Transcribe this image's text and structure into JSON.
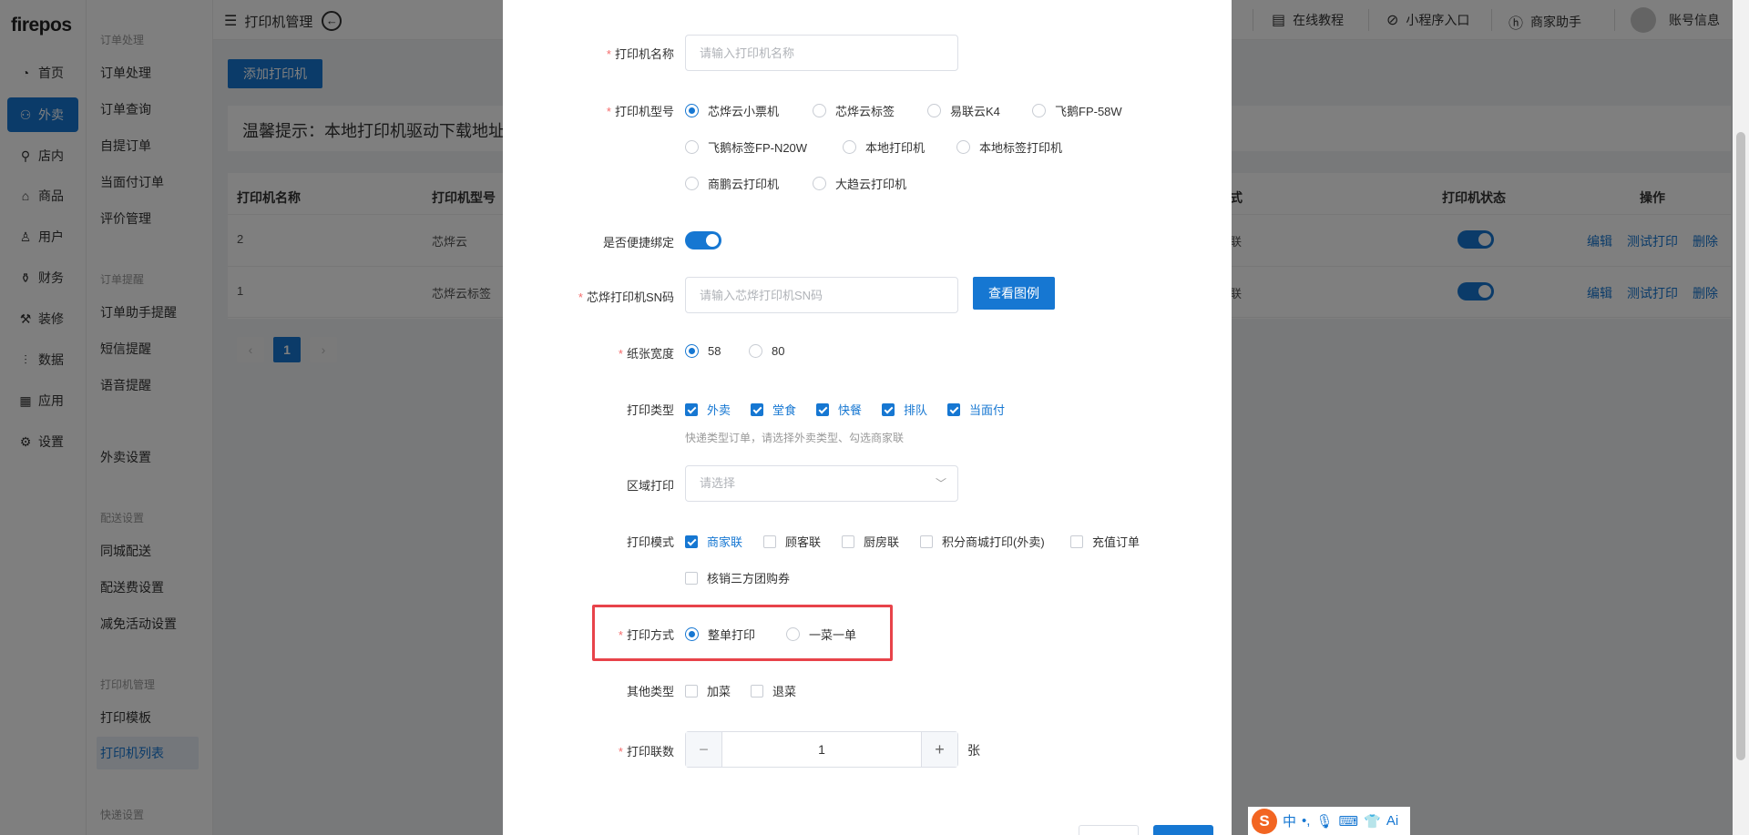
{
  "app": {
    "logo": "firepos"
  },
  "nav_primary": [
    {
      "label": "首页",
      "icon": "home-icon",
      "glyph": "◔",
      "active": false
    },
    {
      "label": "外卖",
      "icon": "scooter-icon",
      "glyph": "⚇",
      "active": true
    },
    {
      "label": "店内",
      "icon": "shop-icon",
      "glyph": "⚲",
      "active": false
    },
    {
      "label": "商品",
      "icon": "bag-icon",
      "glyph": "⌂",
      "active": false
    },
    {
      "label": "用户",
      "icon": "user-icon",
      "glyph": "♙",
      "active": false
    },
    {
      "label": "财务",
      "icon": "money-icon",
      "glyph": "⚱",
      "active": false
    },
    {
      "label": "装修",
      "icon": "brush-icon",
      "glyph": "⚒",
      "active": false
    },
    {
      "label": "数据",
      "icon": "chart-icon",
      "glyph": "⫶",
      "active": false
    },
    {
      "label": "应用",
      "icon": "apps-icon",
      "glyph": "▦",
      "active": false
    },
    {
      "label": "设置",
      "icon": "gear-icon",
      "glyph": "⚙",
      "active": false
    }
  ],
  "nav_secondary": {
    "group_order": "订单处理",
    "order_items": [
      "订单处理",
      "订单查询",
      "自提订单",
      "当面付订单",
      "评价管理"
    ],
    "group_remind": "订单提醒",
    "remind_items": [
      "订单助手提醒",
      "短信提醒",
      "语音提醒"
    ],
    "takeout_settings": "外卖设置",
    "group_delivery": "配送设置",
    "delivery_items": [
      "同城配送",
      "配送费设置",
      "减免活动设置"
    ],
    "group_printer": "打印机管理",
    "printer_items": [
      "打印模板",
      "打印机列表"
    ],
    "group_express": "快递设置"
  },
  "topbar": {
    "breadcrumb": "打印机管理",
    "tutorial": "在线教程",
    "miniapp": "小程序入口",
    "assistant": "商家助手",
    "account": "账号信息"
  },
  "page": {
    "add_button": "添加打印机",
    "tip": "温馨提示：本地打印机驱动下载地址",
    "table": {
      "col_name": "打印机名称",
      "col_model": "打印机型号",
      "col_mode_partial": "式",
      "col_status": "打印机状态",
      "col_ops": "操作",
      "rows": [
        {
          "name": "2",
          "model": "芯烨云",
          "mode_partial": "联"
        },
        {
          "name": "1",
          "model": "芯烨云标签",
          "mode_partial": "联"
        }
      ],
      "op_edit": "编辑",
      "op_test": "测试打印",
      "op_delete": "删除"
    },
    "pagination": {
      "prev": "‹",
      "current": "1",
      "next": "›"
    }
  },
  "dialog": {
    "name_label": "打印机名称",
    "name_placeholder": "请输入打印机名称",
    "model_label": "打印机型号",
    "models": [
      "芯烨云小票机",
      "芯烨云标签",
      "易联云K4",
      "飞鹅FP-58W",
      "飞鹅标签FP-N20W",
      "本地打印机",
      "本地标签打印机",
      "商鹏云打印机",
      "大趋云打印机"
    ],
    "model_selected": "芯烨云小票机",
    "bind_label": "是否便捷绑定",
    "sn_label": "芯烨打印机SN码",
    "sn_placeholder": "请输入芯烨打印机SN码",
    "view_example": "查看图例",
    "paper_label": "纸张宽度",
    "paper_options": [
      "58",
      "80"
    ],
    "paper_selected": "58",
    "print_type_label": "打印类型",
    "print_types": [
      "外卖",
      "堂食",
      "快餐",
      "排队",
      "当面付"
    ],
    "print_type_hint": "快递类型订单，请选择外卖类型、勾选商家联",
    "area_label": "区域打印",
    "area_placeholder": "请选择",
    "mode_label": "打印模式",
    "modes": [
      {
        "label": "商家联",
        "checked": true
      },
      {
        "label": "顾客联",
        "checked": false
      },
      {
        "label": "厨房联",
        "checked": false
      },
      {
        "label": "积分商城打印(外卖)",
        "checked": false
      },
      {
        "label": "充值订单",
        "checked": false
      },
      {
        "label": "核销三方团购券",
        "checked": false
      }
    ],
    "method_label": "打印方式",
    "methods": [
      "整单打印",
      "一菜一单"
    ],
    "method_selected": "整单打印",
    "other_label": "其他类型",
    "others": [
      "加菜",
      "退菜"
    ],
    "copies_label": "打印联数",
    "copies_value": "1",
    "copies_unit": "张"
  },
  "ime": {
    "logo": "S",
    "lang": "中",
    "punct": "•,"
  },
  "colors": {
    "primary": "#1677d2",
    "danger": "#e8434a",
    "required": "#f56c6c"
  }
}
